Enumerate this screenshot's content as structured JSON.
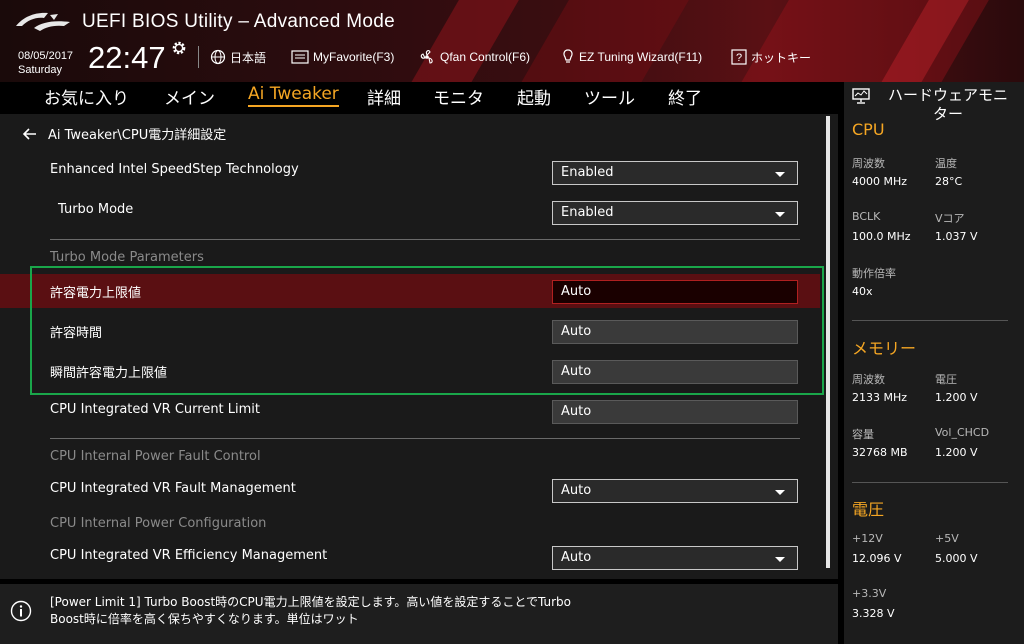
{
  "header": {
    "title": "UEFI BIOS Utility – Advanced Mode",
    "date": "08/05/2017",
    "day": "Saturday",
    "time": "22:47",
    "toolbar": [
      {
        "label": "日本語",
        "icon": "globe-icon"
      },
      {
        "label": "MyFavorite(F3)",
        "icon": "favorite-icon"
      },
      {
        "label": "Qfan Control(F6)",
        "icon": "fan-icon"
      },
      {
        "label": "EZ Tuning Wizard(F11)",
        "icon": "bulb-icon"
      },
      {
        "label": "ホットキー",
        "icon": "hotkey-icon"
      }
    ]
  },
  "tabs": [
    {
      "label": "お気に入り",
      "active": false
    },
    {
      "label": "メイン",
      "active": false
    },
    {
      "label": "Ai Tweaker",
      "active": true
    },
    {
      "label": "詳細",
      "active": false
    },
    {
      "label": "モニタ",
      "active": false
    },
    {
      "label": "起動",
      "active": false
    },
    {
      "label": "ツール",
      "active": false
    },
    {
      "label": "終了",
      "active": false
    }
  ],
  "breadcrumb": "Ai Tweaker\\CPU電力詳細設定",
  "settings": {
    "speedstep": {
      "label": "Enhanced Intel SpeedStep Technology",
      "value": "Enabled"
    },
    "turbo_mode": {
      "label": "Turbo Mode",
      "value": "Enabled"
    },
    "turbo_params_header": "Turbo Mode Parameters",
    "power_limit": {
      "label": "許容電力上限値",
      "value": "Auto"
    },
    "time_window": {
      "label": "許容時間",
      "value": "Auto"
    },
    "short_power_limit": {
      "label": "瞬間許容電力上限値",
      "value": "Auto"
    },
    "vr_current_limit": {
      "label": "CPU Integrated VR Current Limit",
      "value": "Auto"
    },
    "fault_control_header": "CPU Internal Power Fault Control",
    "vr_fault": {
      "label": "CPU Integrated VR Fault Management",
      "value": "Auto"
    },
    "power_config_header": "CPU Internal Power Configuration",
    "vr_efficiency": {
      "label": "CPU Integrated VR Efficiency Management",
      "value": "Auto"
    }
  },
  "help": {
    "line1": "[Power Limit 1] Turbo Boost時のCPU電力上限値を設定します。高い値を設定することでTurbo",
    "line2": "Boost時に倍率を高く保ちやすくなります。単位はワット"
  },
  "hw_monitor": {
    "title_line1": "ハードウェアモニ",
    "title_line2": "ター",
    "cpu": {
      "title": "CPU",
      "freq_key": "周波数",
      "freq_val": "4000 MHz",
      "temp_key": "温度",
      "temp_val": "28°C",
      "bclk_key": "BCLK",
      "bclk_val": "100.0 MHz",
      "vcore_key": "Vコア",
      "vcore_val": "1.037 V",
      "ratio_key": "動作倍率",
      "ratio_val": "40x"
    },
    "memory": {
      "title": "メモリー",
      "freq_key": "周波数",
      "freq_val": "2133 MHz",
      "volt_key": "電圧",
      "volt_val": "1.200 V",
      "cap_key": "容量",
      "cap_val": "32768 MB",
      "vol_chcd_key": "Vol_CHCD",
      "vol_chcd_val": "1.200 V"
    },
    "voltage": {
      "title": "電圧",
      "v12_key": "+12V",
      "v12_val": "12.096 V",
      "v5_key": "+5V",
      "v5_val": "5.000 V",
      "v33_key": "+3.3V",
      "v33_val": "3.328 V"
    }
  },
  "colors": {
    "accent": "#f5a623",
    "highlight_row": "#5a0f12",
    "annotation_box": "#1aa64a"
  }
}
